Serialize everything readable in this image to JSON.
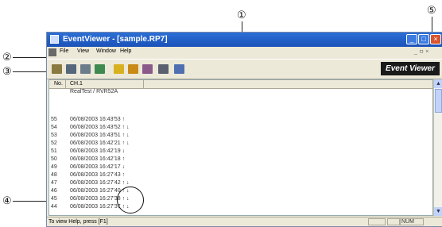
{
  "callouts": [
    "①",
    "②",
    "③",
    "④",
    "⑤"
  ],
  "window": {
    "title": "EventViewer - [sample.RP7]",
    "controls": {
      "minimize": "_",
      "maximize": "□",
      "close": "×"
    }
  },
  "menubar": {
    "items": [
      "File",
      "View",
      "Window",
      "Help"
    ],
    "mdi_controls": "_ ㅁ ×"
  },
  "toolbar": {
    "icons": [
      "open-icon",
      "save-icon",
      "copy-icon",
      "filter-icon",
      "bar-chart-icon",
      "graph-icon",
      "export-icon",
      "print-icon",
      "help-icon"
    ],
    "brand_label": "Event Viewer"
  },
  "table": {
    "headers": {
      "no": "No.",
      "channel": "CH.1"
    },
    "subheader": "RealTest / RVR52A",
    "rows": [
      {
        "no": "55",
        "entry": "06/08/2003 16:43'53 ↑"
      },
      {
        "no": "54",
        "entry": "06/08/2003 16:43'52 ↑ ↓"
      },
      {
        "no": "53",
        "entry": "06/08/2003 16:43'51 ↑ ↓"
      },
      {
        "no": "52",
        "entry": "06/08/2003 16:42'21 ↑ ↓"
      },
      {
        "no": "51",
        "entry": "06/08/2003 16:42'19 ↓"
      },
      {
        "no": "50",
        "entry": "06/08/2003 16:42'18 ↑"
      },
      {
        "no": "49",
        "entry": "06/08/2003 16:42'17 ↓"
      },
      {
        "no": "48",
        "entry": "06/08/2003 16:27'43 ↑"
      },
      {
        "no": "47",
        "entry": "06/08/2003 16:27'42 ↑ ↓"
      },
      {
        "no": "46",
        "entry": "06/08/2003 16:27'40 ↑ ↓"
      },
      {
        "no": "45",
        "entry": "06/08/2003 16:27'38 ↑ ↓"
      },
      {
        "no": "44",
        "entry": "06/08/2003 16:27'37 ↑ ↓"
      }
    ]
  },
  "scrollbar": {
    "up": "▲",
    "down": "▼"
  },
  "statusbar": {
    "text": "To view Help, press [F1]",
    "num": "NUM"
  }
}
